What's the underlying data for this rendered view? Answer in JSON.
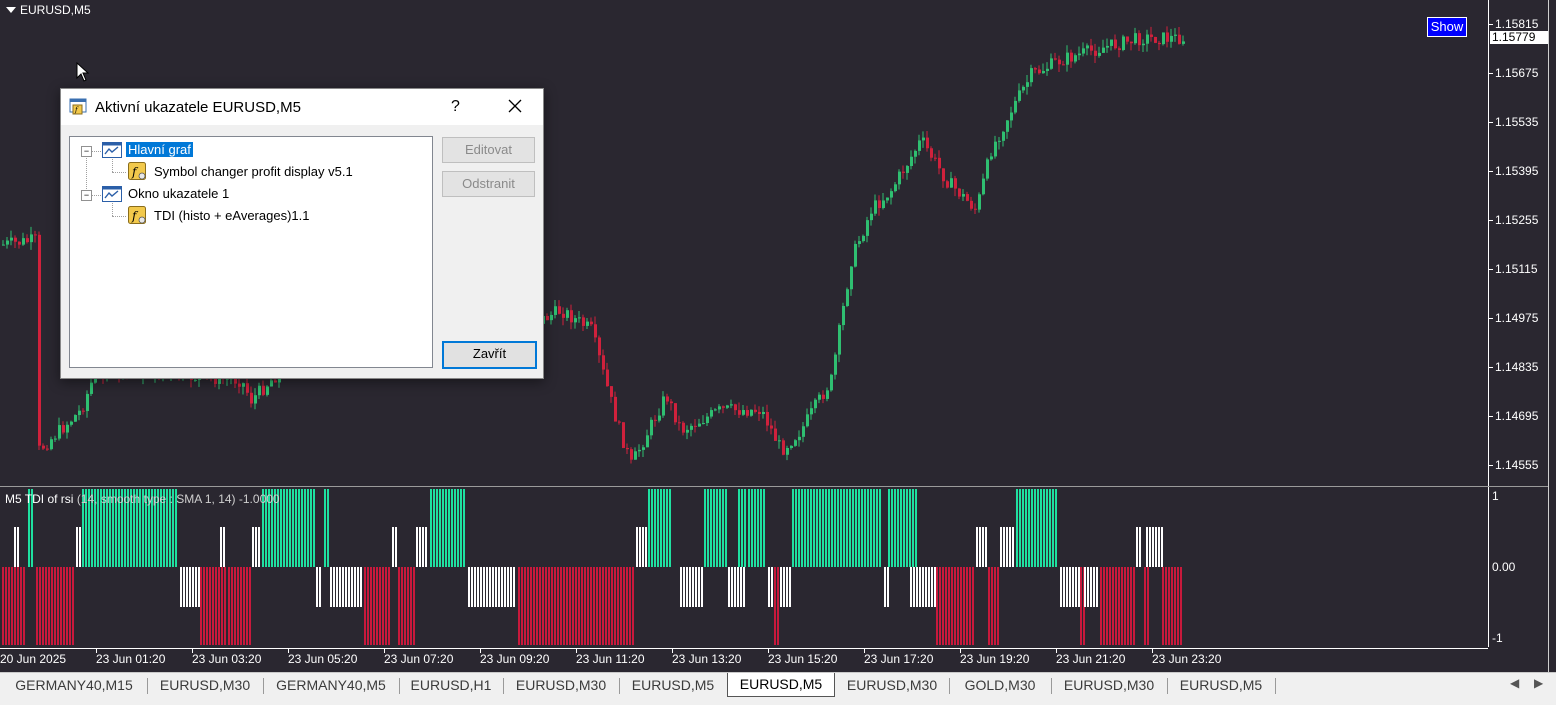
{
  "chart": {
    "symbol_title": "EURUSD,M5",
    "show_button": "Show",
    "current_price": "1.15779",
    "price_labels": [
      "1.15815",
      "1.15675",
      "1.15535",
      "1.15395",
      "1.15255",
      "1.15115",
      "1.14975",
      "1.14835",
      "1.14695",
      "1.14555"
    ],
    "time_labels": [
      "20 Jun 2025",
      "23 Jun 01:20",
      "23 Jun 03:20",
      "23 Jun 05:20",
      "23 Jun 07:20",
      "23 Jun 09:20",
      "23 Jun 11:20",
      "23 Jun 13:20",
      "23 Jun 15:20",
      "23 Jun 17:20",
      "23 Jun 19:20",
      "23 Jun 21:20",
      "23 Jun 23:20"
    ],
    "bull_color": "#2fbf71",
    "bear_color": "#d0213c",
    "background": "#2a2730"
  },
  "indicator": {
    "label_name": "M5 TDI of rsi",
    "label_params": "(14, smooth type :  SMA 1, 14) -1.0000",
    "axis_labels": [
      "1",
      "0.00",
      "-1"
    ],
    "green_color": "#1fe0a0",
    "red_color": "#c8193c",
    "white_color": "#ffffff"
  },
  "dialog": {
    "title": "Aktivní ukazatele EURUSD,M5",
    "help": "?",
    "tree": [
      {
        "label": "Hlavní graf",
        "children": [
          "Symbol changer profit display v5.1"
        ]
      },
      {
        "label": "Okno ukazatele 1",
        "children": [
          "TDI (histo + eAverages)1.1"
        ]
      }
    ],
    "buttons": {
      "edit": "Editovat",
      "remove": "Odstranit",
      "close": "Zavřít"
    }
  },
  "tabs": [
    "GERMANY40,M15",
    "EURUSD,M30",
    "GERMANY40,M5",
    "EURUSD,H1",
    "EURUSD,M30",
    "EURUSD,M5",
    "EURUSD,M5",
    "EURUSD,M30",
    "GOLD,M30",
    "EURUSD,M30",
    "EURUSD,M5"
  ],
  "active_tab": 6
}
